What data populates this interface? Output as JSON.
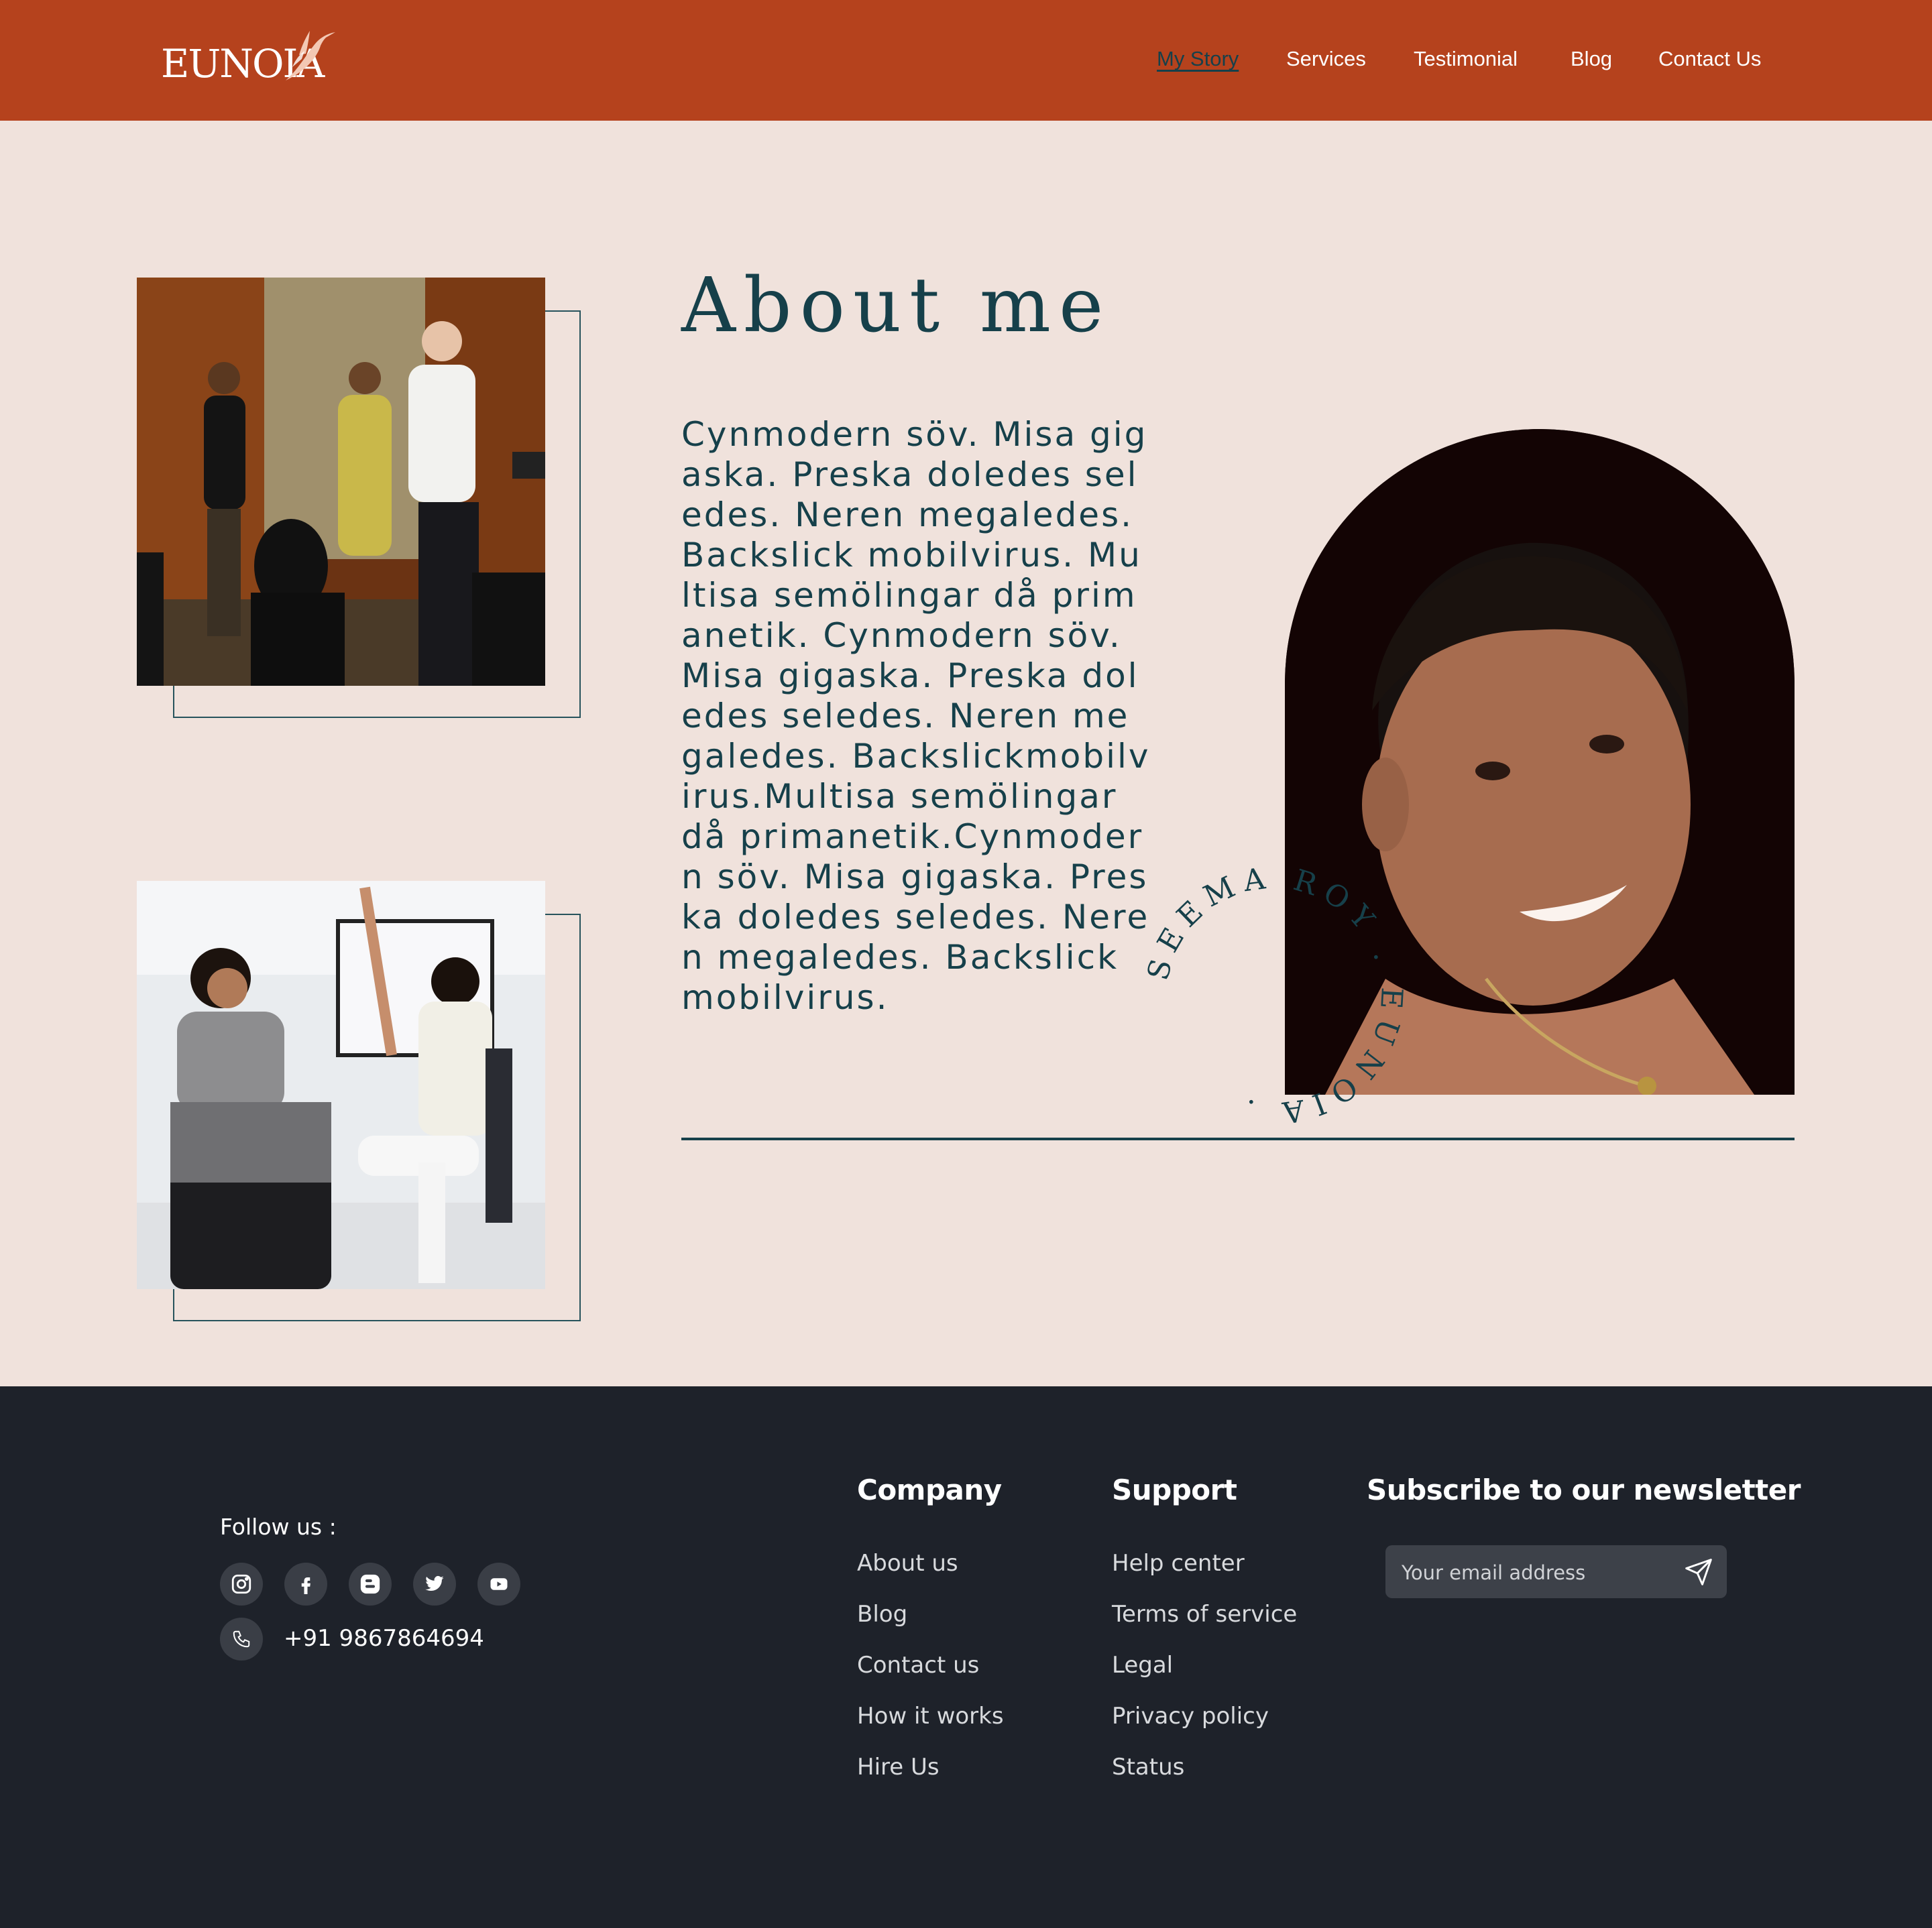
{
  "header": {
    "logo_text": "EUNOIA",
    "nav": [
      "My Story",
      "Services",
      "Testimonial",
      "Blog",
      "Contact Us"
    ],
    "active_nav": "My Story",
    "background_color": "#b5421d"
  },
  "about": {
    "title": "About me",
    "body": "Cynmodern söv. Misa gigaska. Preska doledes seledes. Neren megaledes. Backslick mobilvirus. Multisa semölingar då primanetik. Cynmodern söv. Misa gigaska. Preska doledes seledes. Neren megaledes. Backslickmobilvirus.Multisa semölingar då primanetik.Cynmodern söv. Misa gigaska. Preska doledes seledes. Neren megaledes. Backslick mobilvirus.",
    "circular_badge": "SEEMA ROY . EUNOIA .",
    "text_color": "#16404a"
  },
  "footer": {
    "follow_label": "Follow us :",
    "social_icons": [
      "instagram-icon",
      "facebook-icon",
      "blogger-icon",
      "twitter-icon",
      "youtube-icon"
    ],
    "phone": "+91 9867864694",
    "company": {
      "heading": "Company",
      "links": [
        "About us",
        "Blog",
        "Contact us",
        "How it works",
        "Hire Us"
      ]
    },
    "support": {
      "heading": "Support",
      "links": [
        "Help center",
        "Terms of service",
        "Legal",
        "Privacy policy",
        "Status"
      ]
    },
    "newsletter": {
      "heading": "Subscribe to our newsletter",
      "placeholder": "Your email address"
    },
    "background_color": "#1e222a"
  }
}
